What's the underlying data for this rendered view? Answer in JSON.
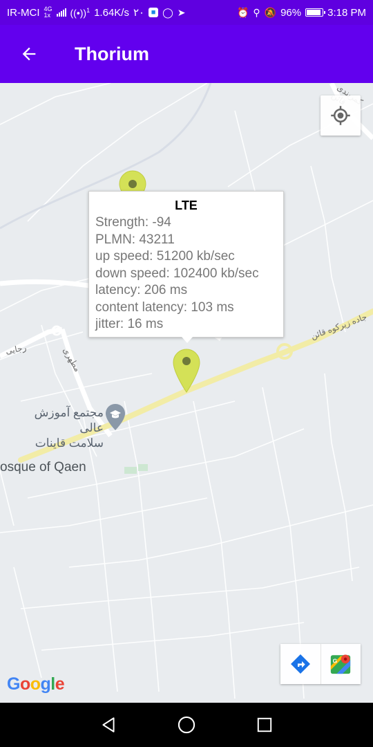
{
  "status_bar": {
    "carrier": "IR-MCI",
    "network_badge_top": "4G",
    "network_badge_bottom": "1x",
    "hotspot_badge": "1",
    "speed": "1.64K/s",
    "date_digits": "۲۰",
    "battery_level": 0.96,
    "battery_percent": "96%",
    "time": "3:18 PM"
  },
  "app_bar": {
    "title": "Thorium",
    "back_icon": "arrow-left-icon",
    "color": "#6200ee",
    "status_color": "#5f00e0"
  },
  "map": {
    "info_window": {
      "title": "LTE",
      "lines": [
        "Strength: -94",
        "PLMN: 43211",
        "up speed: 51200 kb/sec",
        "down speed: 102400 kb/sec",
        "latency: 206 ms",
        "content latency: 103 ms",
        "jitter: 16 ms"
      ]
    },
    "labels": {
      "poi_line1": "مجتمع آموزش عالی",
      "poi_line2": "سلامت قاینات",
      "mosque": "osque of Qaen",
      "road_east": "جاده زیرکوه قائن",
      "street_nw": "رجایی",
      "street_mid": "مطهری",
      "street_ne": "کمربندی قائن"
    },
    "marker_color": "#d4e157",
    "google_logo": "Google"
  },
  "nav_bar": {
    "back_icon": "triangle-back-icon",
    "home_icon": "circle-home-icon",
    "recents_icon": "square-recents-icon"
  }
}
